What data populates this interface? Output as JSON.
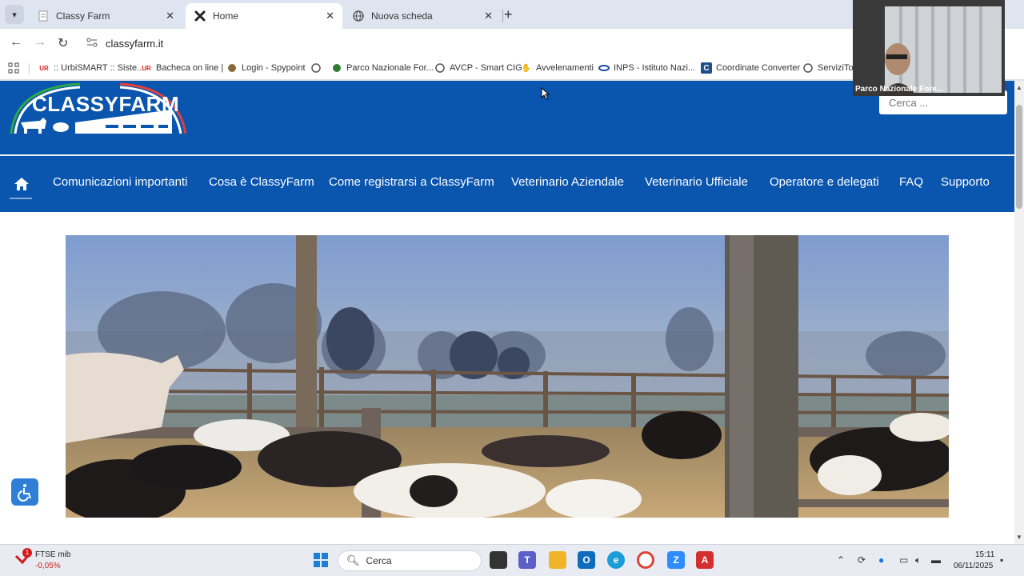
{
  "browser": {
    "tabs": [
      {
        "title": "Classy Farm",
        "active": false
      },
      {
        "title": "Home",
        "active": true
      },
      {
        "title": "Nuova scheda",
        "active": false
      }
    ],
    "url": "classyfarm.it",
    "bookmarks": [
      {
        "label": ":: UrbiSMART :: Siste...",
        "icon": "urbi-icon"
      },
      {
        "label": "Bacheca on line |",
        "icon": "urbi-icon"
      },
      {
        "label": "Login - Spypoint",
        "icon": "spypoint-icon"
      },
      {
        "label": "",
        "icon": "globe-icon"
      },
      {
        "label": "Parco Nazionale For...",
        "icon": "parco-icon"
      },
      {
        "label": "AVCP - Smart CIG",
        "icon": "globe-icon"
      },
      {
        "label": "Avvelenamenti",
        "icon": "paw-icon"
      },
      {
        "label": "INPS - Istituto Nazi...",
        "icon": "inps-icon"
      },
      {
        "label": "Coordinate Converter",
        "icon": "coordinate-icon"
      },
      {
        "label": "ServiziTos",
        "icon": "globe-icon"
      }
    ]
  },
  "site": {
    "logo_text": "CLASSYFARM",
    "search_placeholder": "Cerca ...",
    "menu": [
      "Comunicazioni importanti",
      "Cosa è ClassyFarm",
      "Come registrarsi a ClassyFarm",
      "Veterinario Aziendale",
      "Veterinario Ufficiale",
      "Operatore e delegati",
      "FAQ",
      "Supporto"
    ],
    "colors": {
      "primary": "#0a55ae",
      "white": "#ffffff"
    }
  },
  "video": {
    "participant": "Parco Nazionale Fore..."
  },
  "taskbar": {
    "widget_name": "FTSE mib",
    "widget_value": "-0,05%",
    "widget_badge": "1",
    "search_label": "Cerca",
    "time": "15:11",
    "date": "06/11/2025"
  }
}
